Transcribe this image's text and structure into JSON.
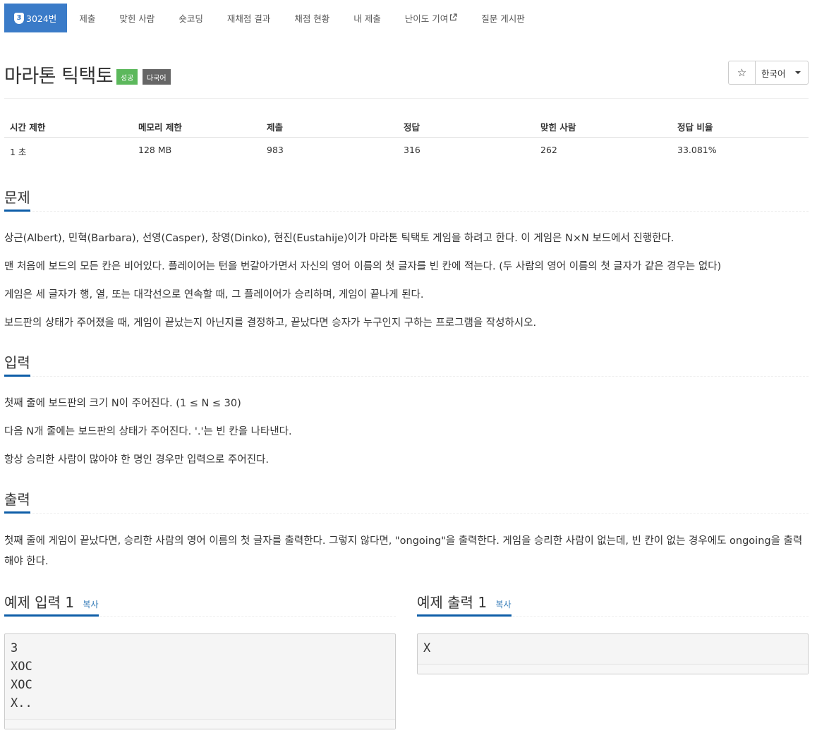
{
  "nav": {
    "problem_number": "3024번",
    "badge": "3",
    "items": [
      "제출",
      "맞힌 사람",
      "숏코딩",
      "재채점 결과",
      "채점 현황",
      "내 제출",
      "난이도 기여",
      "질문 게시판"
    ]
  },
  "title": "마라톤 틱택토",
  "tags": {
    "success": "성공",
    "multilang": "다국어"
  },
  "star_icon": "star-icon",
  "language": "한국어",
  "stats": {
    "headers": [
      "시간 제한",
      "메모리 제한",
      "제출",
      "정답",
      "맞힌 사람",
      "정답 비율"
    ],
    "values": [
      "1 초",
      "128 MB",
      "983",
      "316",
      "262",
      "33.081%"
    ]
  },
  "problem": {
    "heading": "문제",
    "paragraphs": [
      "상근(Albert), 민혁(Barbara), 선영(Casper), 창영(Dinko), 현진(Eustahije)이가 마라톤 틱택토 게임을 하려고 한다. 이 게임은 N×N 보드에서 진행한다.",
      "맨 처음에 보드의 모든 칸은 비어있다. 플레이어는 턴을 번갈아가면서 자신의 영어 이름의 첫 글자를 빈 칸에 적는다. (두 사람의 영어 이름의 첫 글자가 같은 경우는 없다)",
      "게임은 세 글자가 행, 열, 또는 대각선으로 연속할 때, 그 플레이어가 승리하며, 게임이 끝나게 된다.",
      "보드판의 상태가 주어졌을 때, 게임이 끝났는지 아닌지를 결정하고, 끝났다면 승자가 누구인지 구하는 프로그램을 작성하시오."
    ]
  },
  "input": {
    "heading": "입력",
    "paragraphs": [
      "첫째 줄에 보드판의 크기 N이 주어진다. (1 ≤ N ≤ 30)",
      "다음 N개 줄에는 보드판의 상태가 주어진다. '.'는 빈 칸을 나타낸다.",
      "항상 승리한 사람이 많아야 한 명인 경우만 입력으로 주어진다."
    ]
  },
  "output": {
    "heading": "출력",
    "paragraphs": [
      "첫째 줄에 게임이 끝났다면, 승리한 사람의 영어 이름의 첫 글자를 출력한다. 그렇지 않다면, \"ongoing\"을 출력한다. 게임을 승리한 사람이 없는데, 빈 칸이 없는 경우에도 ongoing을 출력해야 한다."
    ]
  },
  "examples": {
    "input_title": "예제 입력 1",
    "output_title": "예제 출력 1",
    "copy_label": "복사",
    "input_text": "3\nXOC\nXOC\nX..",
    "output_text": "X"
  }
}
